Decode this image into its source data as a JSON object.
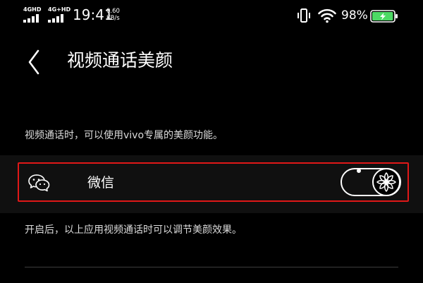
{
  "status_bar": {
    "sim1": "4GHD",
    "sim2": "4G+HD",
    "time": "19:41",
    "speed_value": "0.60",
    "speed_unit": "KB/s",
    "battery_percent": "98%",
    "battery_level": 0.98,
    "battery_color": "#4cd964"
  },
  "header": {
    "back_icon": "chevron-left-icon",
    "title": "视频通话美颜"
  },
  "description": "视频通话时，可以使用vivo专属的美颜功能。",
  "apps": [
    {
      "icon": "wechat-icon",
      "label": "微信",
      "toggle_on": true,
      "highlight_color": "#e01818"
    }
  ],
  "footnote": "开启后，以上应用视频通话时可以调节美颜效果。"
}
